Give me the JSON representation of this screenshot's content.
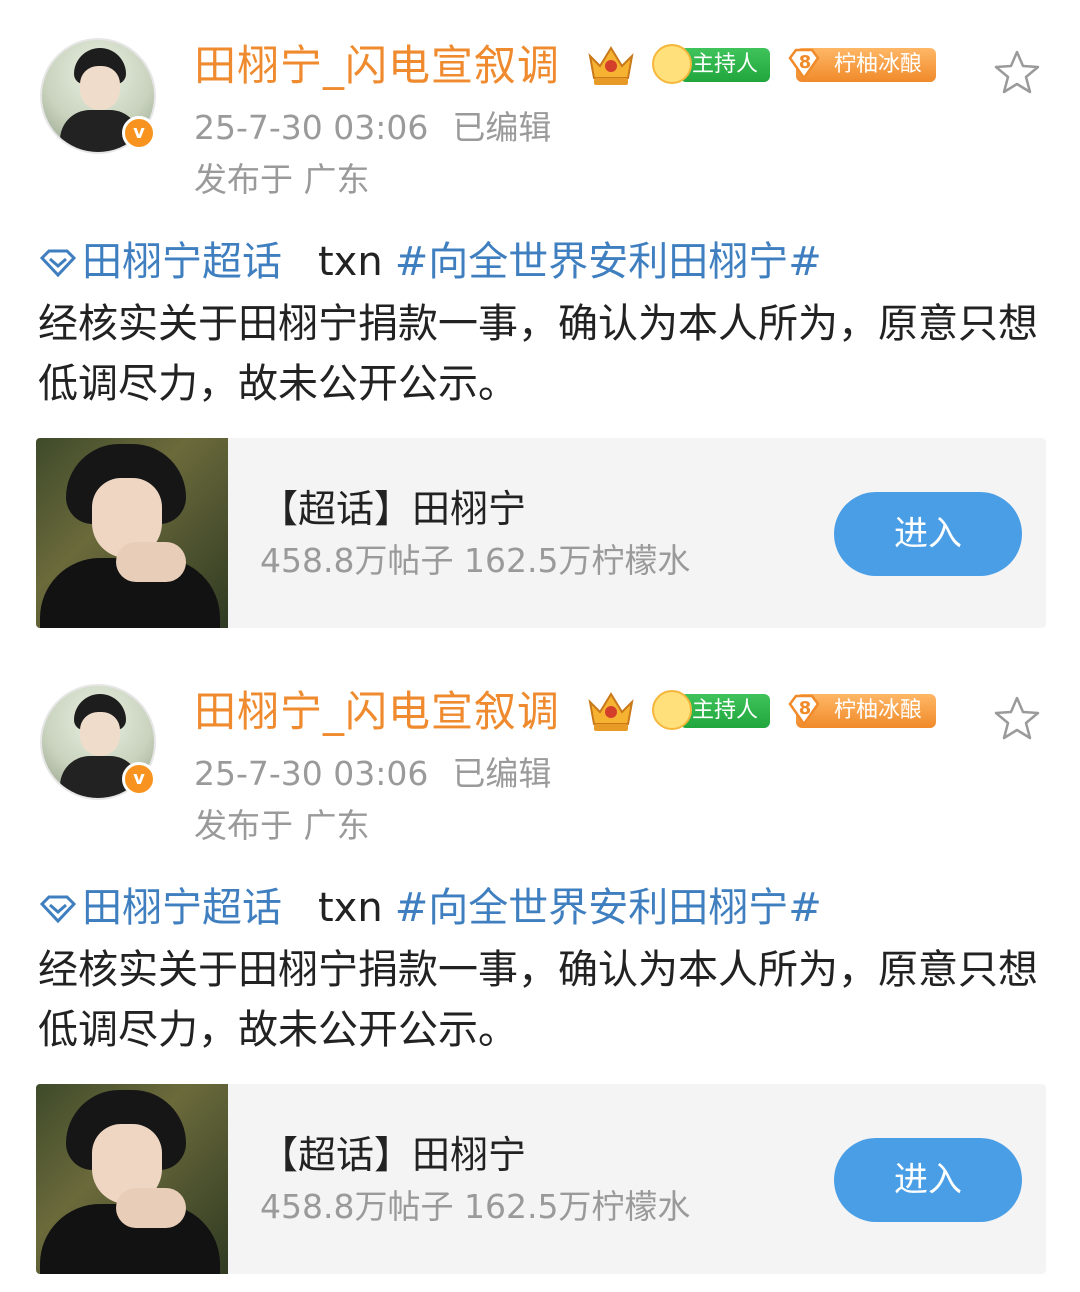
{
  "posts": [
    {
      "username": "田栩宁_闪电宣叙调",
      "host_badge": "主持人",
      "level_number": "8",
      "level_label": "柠柚冰酿",
      "timestamp": "25-7-30 03:06",
      "edited": "已编辑",
      "location": "发布于 广东",
      "topic_link": "田栩宁超话",
      "tag_prefix": "txn",
      "hashtag": "#向全世界安利田栩宁#",
      "body": "经核实关于田栩宁捐款一事，确认为本人所为，原意只想低调尽力，故未公开公示。",
      "card": {
        "title": "【超话】田栩宁",
        "stats": "458.8万帖子 162.5万柠檬水",
        "button": "进入"
      }
    },
    {
      "username": "田栩宁_闪电宣叙调",
      "host_badge": "主持人",
      "level_number": "8",
      "level_label": "柠柚冰酿",
      "timestamp": "25-7-30 03:06",
      "edited": "已编辑",
      "location": "发布于 广东",
      "topic_link": "田栩宁超话",
      "tag_prefix": "txn",
      "hashtag": "#向全世界安利田栩宁#",
      "body": "经核实关于田栩宁捐款一事，确认为本人所为，原意只想低调尽力，故未公开公示。",
      "card": {
        "title": "【超话】田栩宁",
        "stats": "458.8万帖子 162.5万柠檬水",
        "button": "进入"
      }
    }
  ],
  "colors": {
    "username": "#ef8a2e",
    "link": "#3f7fc0",
    "meta": "#9a9a9a",
    "button": "#4a9ee6",
    "host_badge": "#20a63d",
    "level_badge": "#f08a2a"
  },
  "icons": [
    "crown-icon",
    "host-mascot-icon",
    "level-gem-icon",
    "star-icon",
    "verified-icon",
    "diamond-topic-icon"
  ]
}
